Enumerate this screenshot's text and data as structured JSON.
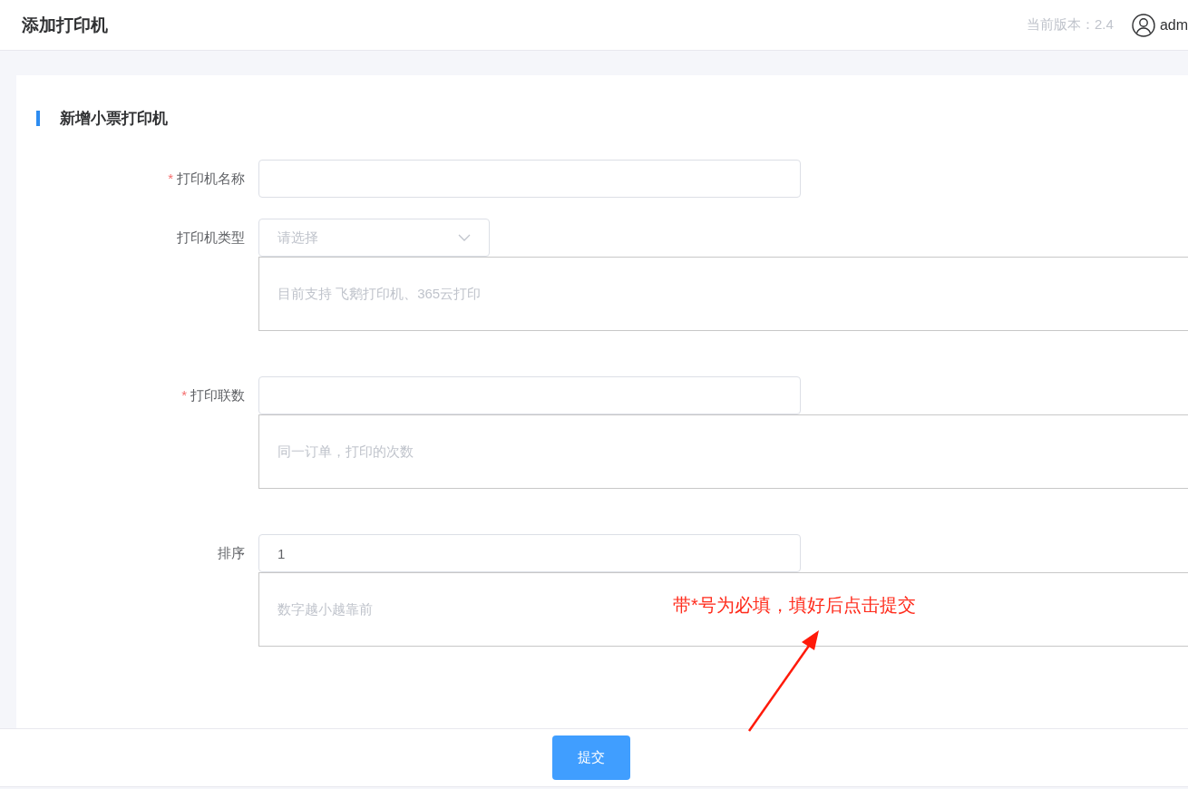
{
  "header": {
    "title": "添加打印机",
    "version": "当前版本：2.4",
    "user": "adm"
  },
  "section": {
    "title": "新增小票打印机"
  },
  "fields": [
    {
      "kind": "input",
      "label": "打印机名称",
      "required": true
    },
    {
      "kind": "select",
      "label": "打印机类型",
      "required": false,
      "placeholder": "请选择",
      "hint": "目前支持 飞鹅打印机、365云打印"
    },
    {
      "kind": "input",
      "label": "打印联数",
      "required": true,
      "hint": "同一订单，打印的次数"
    },
    {
      "kind": "input",
      "label": "排序",
      "required": false,
      "value": "1",
      "hint": "数字越小越靠前"
    }
  ],
  "required_mark": "*",
  "submit": "提交",
  "annotation": "带*号为必填，填好后点击提交"
}
